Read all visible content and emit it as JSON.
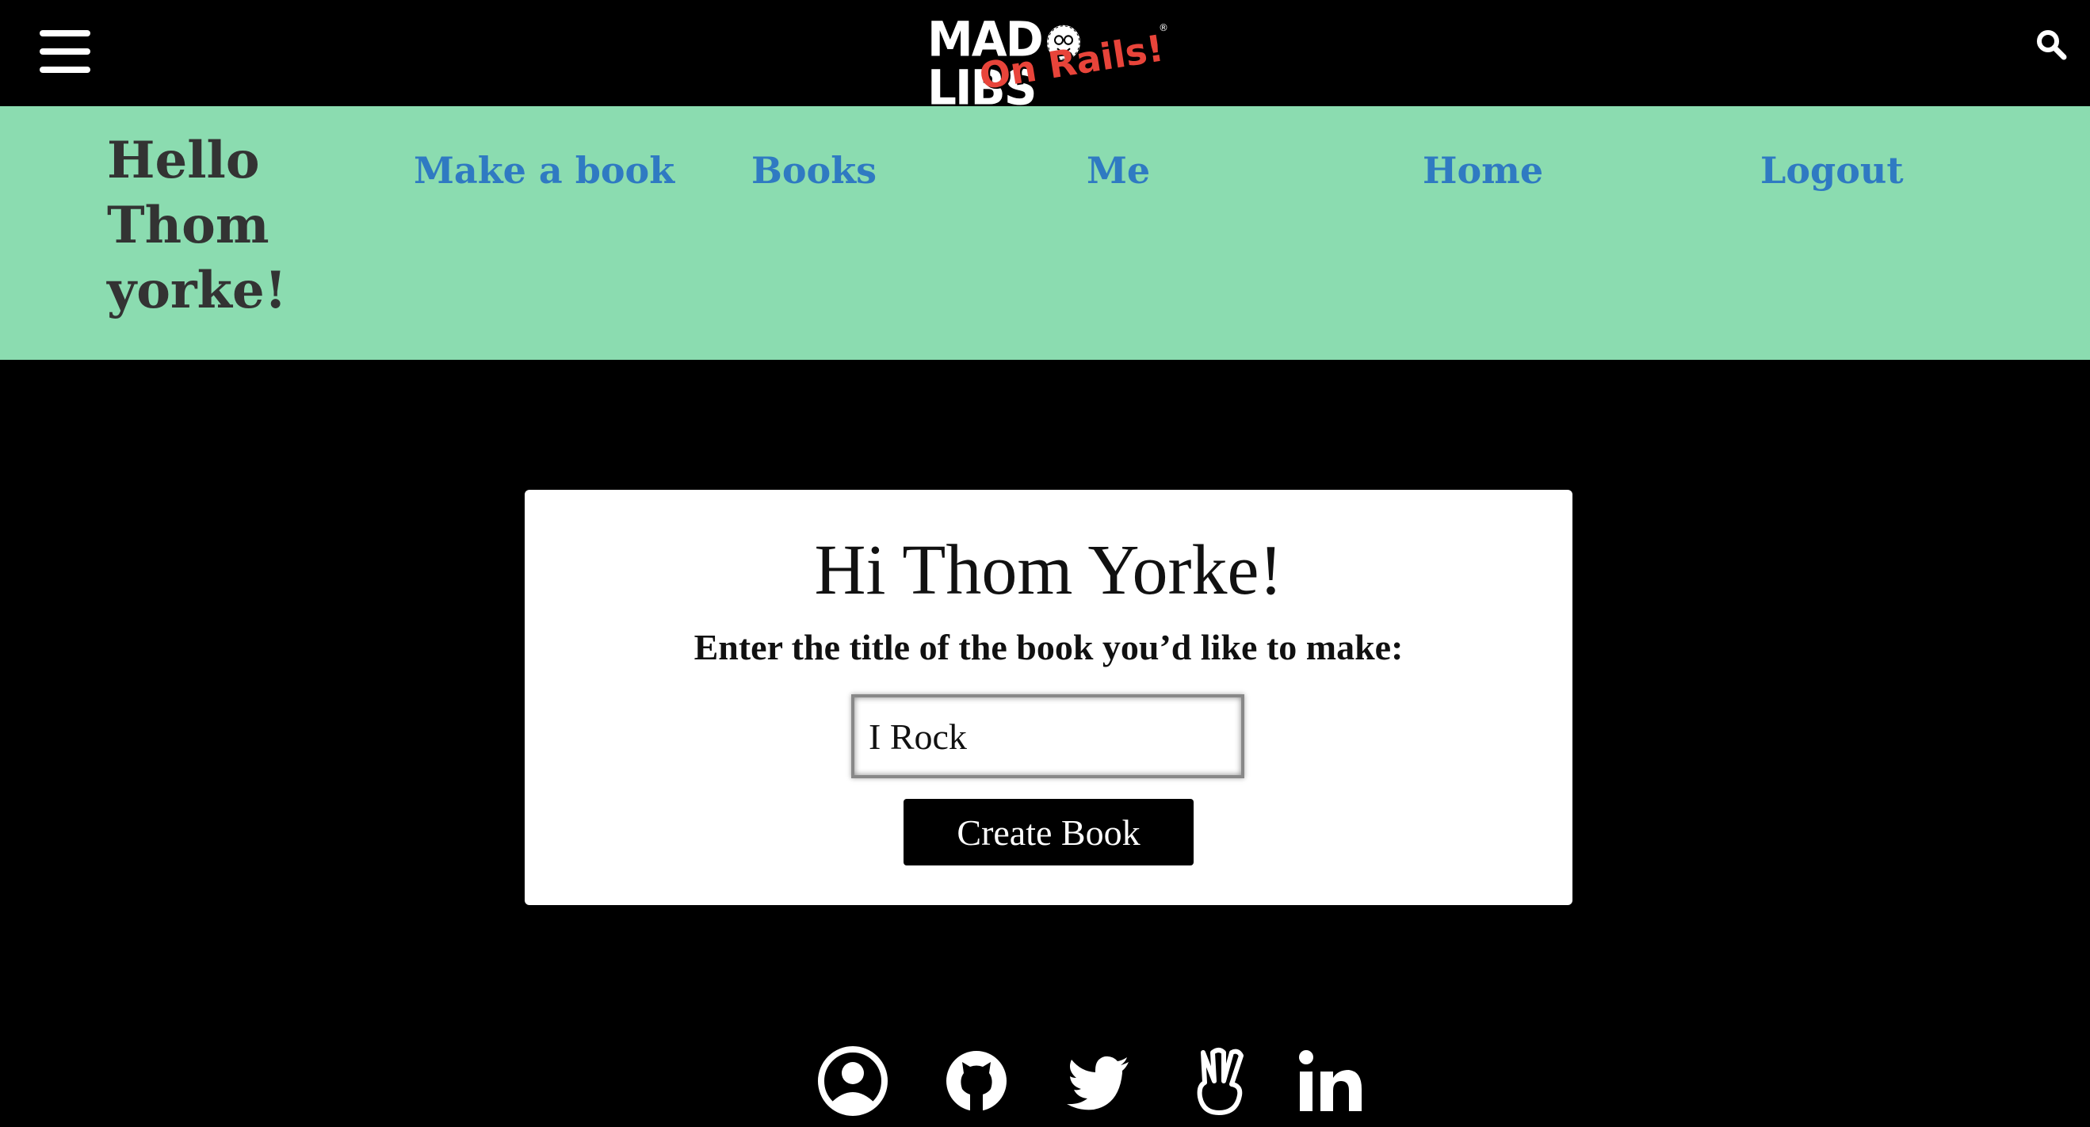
{
  "header": {
    "menu_icon": "hamburger-menu-icon",
    "logo_main": "MAD LIBS",
    "logo_sub": "On Rails!",
    "logo_registered": "®",
    "search_icon": "search-icon"
  },
  "nav": {
    "greeting": "Hello Thom yorke!",
    "links": [
      "Make a book",
      "Books",
      "Me",
      "Home",
      "Logout"
    ]
  },
  "card": {
    "title": "Hi Thom Yorke!",
    "prompt": "Enter the title of the book you’d like to make:",
    "input_value": "I Rock",
    "button_label": "Create Book"
  },
  "footer": {
    "icons": [
      "user-circle-icon",
      "github-icon",
      "twitter-icon",
      "peace-hand-icon",
      "linkedin-icon"
    ]
  },
  "colors": {
    "nav_background": "#8bdcb0",
    "nav_link": "#2f7ac2",
    "greeting_text": "#333333",
    "logo_accent": "#e8443a"
  }
}
